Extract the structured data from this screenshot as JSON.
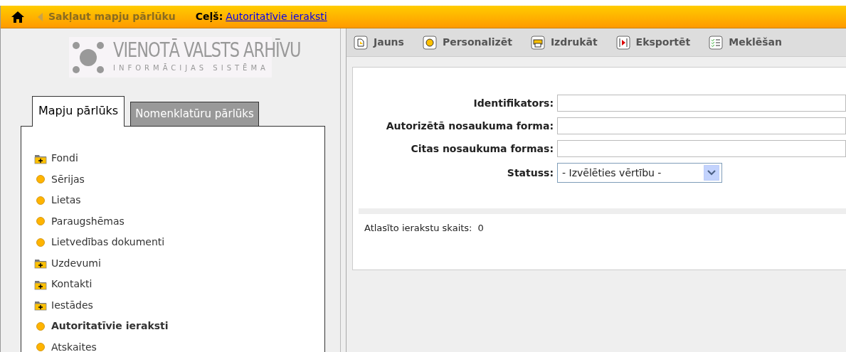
{
  "top_bar": {
    "collapse_label": "Sakļaut mapju pārlūku",
    "path_label": "Ceļš:",
    "path_link": "Autoritatīvie ieraksti"
  },
  "logo": {
    "line_1": "VIENOTĀ VALSTS ARHĪVU",
    "line_2": "INFORMĀCIJAS SISTĒMA"
  },
  "tabs": [
    {
      "label": "Mapju pārlūks",
      "selected": true
    },
    {
      "label": "Nomenklatūru pārlūks",
      "selected": false
    }
  ],
  "tree": [
    {
      "label": "Fondi",
      "kind": "folder",
      "selected": false
    },
    {
      "label": "Sērijas",
      "kind": "leaf",
      "selected": false
    },
    {
      "label": "Lietas",
      "kind": "leaf",
      "selected": false
    },
    {
      "label": "Paraugshēmas",
      "kind": "leaf",
      "selected": false
    },
    {
      "label": "Lietvedības dokumenti",
      "kind": "leaf",
      "selected": false
    },
    {
      "label": "Uzdevumi",
      "kind": "folder",
      "selected": false
    },
    {
      "label": "Kontakti",
      "kind": "folder",
      "selected": false
    },
    {
      "label": "Iestādes",
      "kind": "folder",
      "selected": false
    },
    {
      "label": "Autoritatīvie ieraksti",
      "kind": "leaf",
      "selected": true
    },
    {
      "label": "Atskaites",
      "kind": "leaf",
      "selected": false
    }
  ],
  "toolbar": [
    {
      "label": "Jauns",
      "kind": "new"
    },
    {
      "label": "Personalizēt",
      "kind": "personalize"
    },
    {
      "label": "Izdrukāt",
      "kind": "print"
    },
    {
      "label": "Eksportēt",
      "kind": "export"
    },
    {
      "label": "Meklēšan",
      "kind": "search"
    }
  ],
  "form": [
    {
      "label": "Identifikators:",
      "kind": "text"
    },
    {
      "label": "Autorizētā nosaukuma forma:",
      "kind": "text"
    },
    {
      "label": "Citas nosaukuma formas:",
      "kind": "text"
    },
    {
      "label": "Statuss:",
      "kind": "select",
      "value": "- Izvēlēties vērtību -"
    }
  ],
  "result": {
    "label": "Atlasīto ierakstu skaits:",
    "count": "0"
  }
}
